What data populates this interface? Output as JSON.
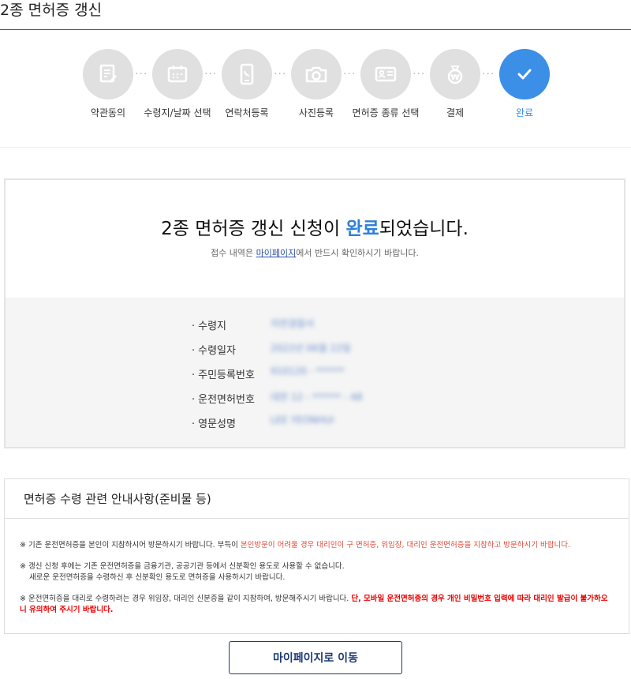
{
  "page": {
    "title": "2종 면허증 갱신"
  },
  "steps": [
    {
      "label": "약관동의",
      "icon": "document-edit-icon"
    },
    {
      "label": "수령지/날짜 선택",
      "icon": "calendar-icon"
    },
    {
      "label": "연락처등록",
      "icon": "phone-icon"
    },
    {
      "label": "사진등록",
      "icon": "camera-icon"
    },
    {
      "label": "면허증 종류 선택",
      "icon": "id-card-icon"
    },
    {
      "label": "결제",
      "icon": "money-bag-icon"
    },
    {
      "label": "완료",
      "icon": "check-icon",
      "active": true
    }
  ],
  "completion": {
    "title_before": "2종 면허증 갱신 신청이 ",
    "title_accent": "완료",
    "title_after": "되었습니다.",
    "sub_before": "접수 내역은 ",
    "sub_link": "마이페이지",
    "sub_after": "에서 반드시 확인하시기 바랍니다.",
    "fields": [
      {
        "label": "수령지",
        "value": "지연경찰서"
      },
      {
        "label": "수령일자",
        "value": "2022년 06월 22일"
      },
      {
        "label": "주민등록번호",
        "value": "910120 - ******"
      },
      {
        "label": "운전면허번호",
        "value": "대전 12 - ****** - 48"
      },
      {
        "label": "영문성명",
        "value": "LEE YEONHUI"
      }
    ]
  },
  "notice": {
    "heading": "면허증 수령 관련 안내사항(준비물 등)",
    "item1_a": "※ 기존 운전면허증을 본인이 지참하시어 방문하시기 바랍니다. 부득이 ",
    "item1_red": "본인방문이 어려울 경우 대리인이 구 면허증, 위임장, 대리인 운전면허증을 지참하고 방문하시기 바랍니다.",
    "item2_line1": "※ 갱신 신청 후에는 기존 운전면허증을 금융기관, 공공기관 등에서 신분확인 용도로 사용할 수 없습니다.",
    "item2_line2": "새로운 운전면허증을 수령하신 후 신분확인 용도로 면허증을 사용하시기 바랍니다.",
    "item3_a": "※ 운전면허증을 대리로 수령하려는 경우 위임장, 대리인 신분증을 같이 지참하여, 방문해주시기 바랍니다. ",
    "item3_red": "단, 모바일 운전면허증의 경우 개인 비밀번호 입력에 따라 대리인 발급이 불가하오니 유의하여 주시기 바랍니다."
  },
  "actions": {
    "mypage_button": "마이페이지로 이동"
  },
  "colors": {
    "accent": "#3b8fe6",
    "step_inactive": "#e0e0e0",
    "notice_red": "#e04a3a",
    "button_navy": "#1f3b7a"
  }
}
